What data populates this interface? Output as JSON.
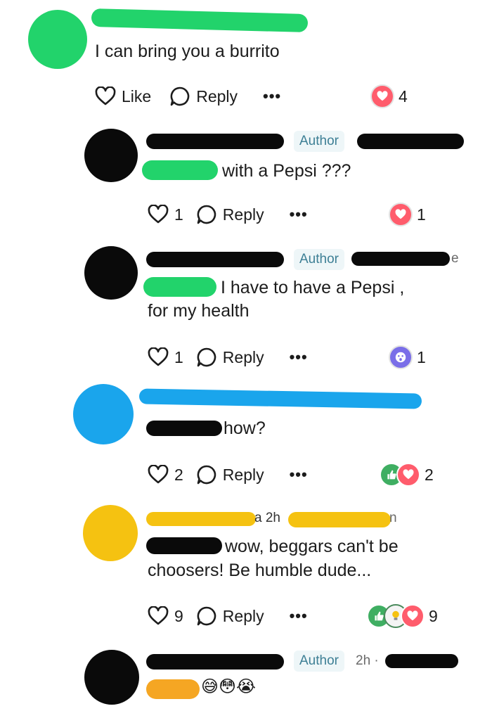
{
  "comments": [
    {
      "text": "I can bring you a burrito",
      "like_label": "Like",
      "reply_label": "Reply",
      "more_label": "•••",
      "reaction_count": "4"
    },
    {
      "author_badge": "Author",
      "text": "with a Pepsi ???",
      "like_count": "1",
      "reply_label": "Reply",
      "more_label": "•••",
      "reaction_count": "1"
    },
    {
      "author_badge": "Author",
      "meta_suffix": "e",
      "text_line1": "I have to have a Pepsi ,",
      "text_line2": "for my health",
      "like_count": "1",
      "reply_label": "Reply",
      "more_label": "•••",
      "reaction_count": "1"
    },
    {
      "text": "how?",
      "like_count": "2",
      "reply_label": "Reply",
      "more_label": "•••",
      "reaction_count": "2"
    },
    {
      "meta_prefix": "a 2h",
      "meta_suffix": "n",
      "text_line1": "wow, beggars can't be",
      "text_line2": "choosers! Be humble dude...",
      "like_count": "9",
      "reply_label": "Reply",
      "more_label": "•••",
      "reaction_count": "9"
    },
    {
      "author_badge": "Author",
      "meta": "2h ·",
      "emojis": "😅😳😭"
    }
  ],
  "colors": {
    "green_scribble": "#22d36b",
    "black_scribble": "#0a0a0a",
    "blue_scribble": "#1aa5ec",
    "yellow_scribble": "#f5c211",
    "heart_reaction": "#ff5c6c",
    "badge_text": "#3d7f95"
  }
}
